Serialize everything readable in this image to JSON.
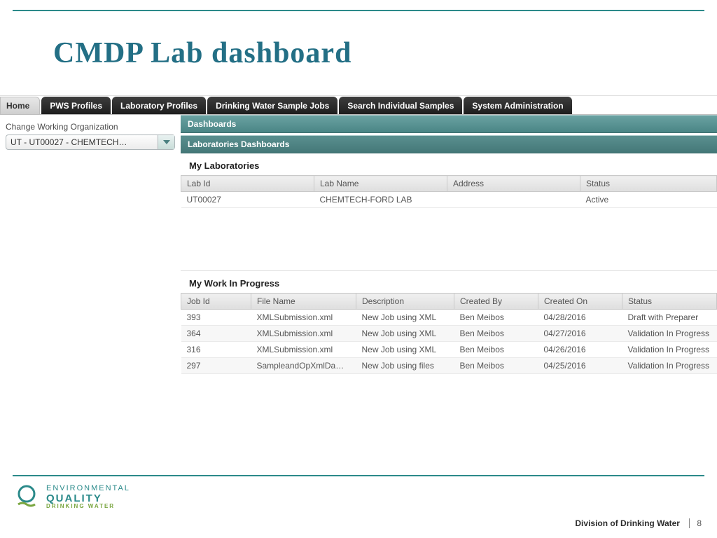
{
  "slide_title": "CMDP Lab dashboard",
  "tabs": {
    "home": "Home",
    "pws": "PWS Profiles",
    "lab": "Laboratory Profiles",
    "jobs": "Drinking Water Sample Jobs",
    "search": "Search Individual Samples",
    "admin": "System Administration"
  },
  "sidebar": {
    "label": "Change Working Organization",
    "value": "UT - UT00027 - CHEMTECH…"
  },
  "panels": {
    "main": "Dashboards",
    "sub": "Laboratories Dashboards"
  },
  "labs": {
    "title": "My Laboratories",
    "columns": {
      "id": "Lab Id",
      "name": "Lab Name",
      "address": "Address",
      "status": "Status"
    },
    "rows": [
      {
        "id": "UT00027",
        "name": "CHEMTECH-FORD LAB",
        "address": "",
        "status": "Active"
      }
    ]
  },
  "wip": {
    "title": "My Work In Progress",
    "columns": {
      "id": "Job Id",
      "file": "File Name",
      "desc": "Description",
      "by": "Created By",
      "on": "Created On",
      "status": "Status"
    },
    "rows": [
      {
        "id": "393",
        "file": "XMLSubmission.xml",
        "desc": "New Job using XML",
        "by": "Ben Meibos",
        "on": "04/28/2016",
        "status": "Draft with Preparer"
      },
      {
        "id": "364",
        "file": "XMLSubmission.xml",
        "desc": "New Job using XML",
        "by": "Ben Meibos",
        "on": "04/27/2016",
        "status": "Validation In Progress"
      },
      {
        "id": "316",
        "file": "XMLSubmission.xml",
        "desc": "New Job using XML",
        "by": "Ben Meibos",
        "on": "04/26/2016",
        "status": "Validation In Progress"
      },
      {
        "id": "297",
        "file": "SampleandOpXmlDa…",
        "desc": "New Job using files",
        "by": "Ben Meibos",
        "on": "04/25/2016",
        "status": "Validation In Progress"
      }
    ]
  },
  "logo": {
    "l1": "ENVIRONMENTAL",
    "l2": "QUALITY",
    "l3": "DRINKING WATER"
  },
  "footer": {
    "division": "Division of Drinking Water",
    "page": "8"
  }
}
